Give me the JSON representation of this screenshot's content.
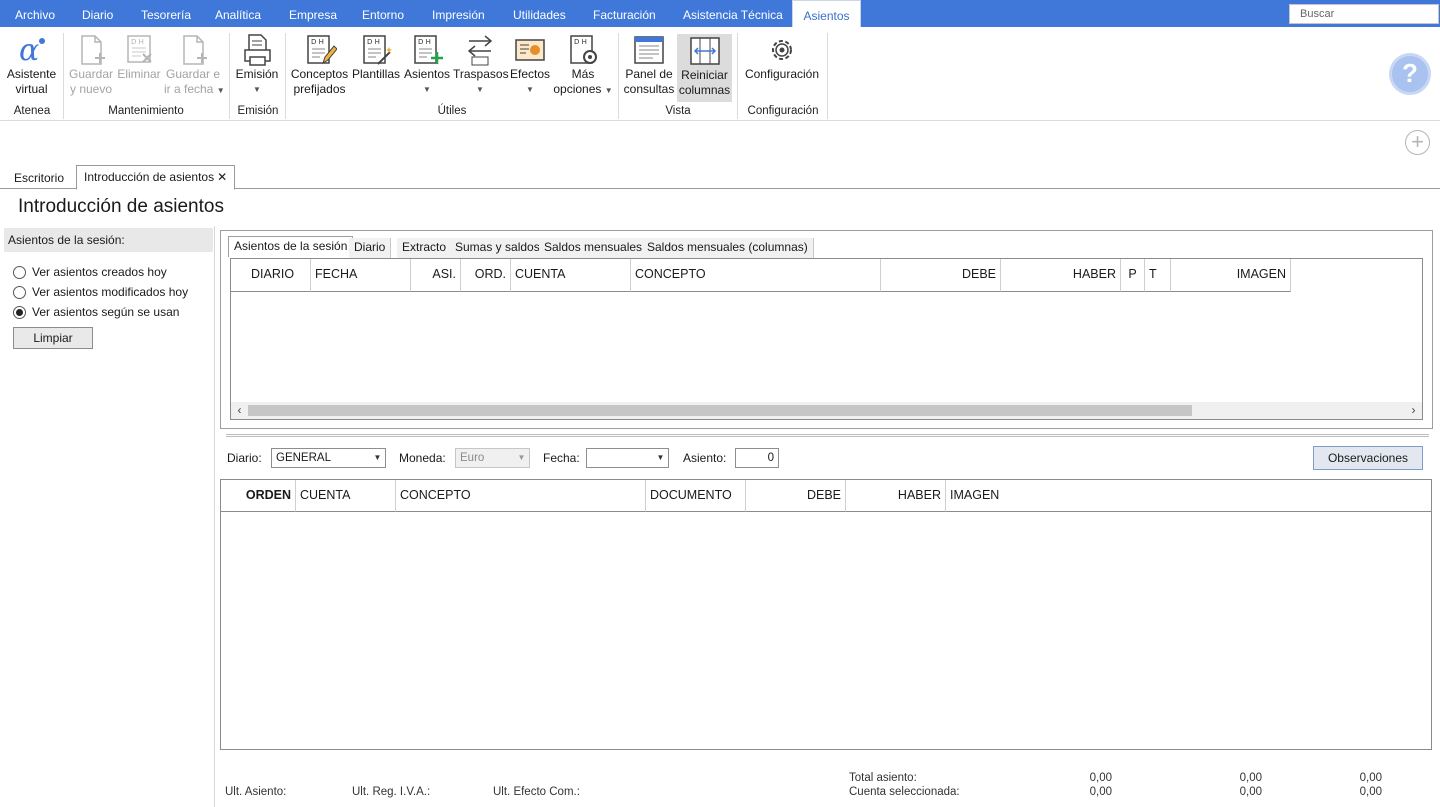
{
  "menu": {
    "items": [
      "Archivo",
      "Diario",
      "Tesorería",
      "Analítica",
      "Empresa",
      "Entorno",
      "Impresión",
      "Utilidades",
      "Facturación",
      "Asistencia Técnica",
      "Asientos"
    ],
    "search_placeholder": "Buscar"
  },
  "ribbon": {
    "asistente": [
      "Asistente",
      "virtual"
    ],
    "guardar_nuevo": [
      "Guardar",
      "y nuevo"
    ],
    "eliminar": "Eliminar",
    "guardar_fecha": [
      "Guardar e",
      "ir a fecha"
    ],
    "emision": "Emisión",
    "conceptos": [
      "Conceptos",
      "prefijados"
    ],
    "plantillas": "Plantillas",
    "asientos": "Asientos",
    "traspasos": "Traspasos",
    "efectos": "Efectos",
    "mas_opciones": [
      "Más",
      "opciones"
    ],
    "panel_consultas": [
      "Panel de",
      "consultas"
    ],
    "reiniciar_columnas": [
      "Reiniciar",
      "columnas"
    ],
    "configuracion": "Configuración",
    "groups": {
      "atenea": "Atenea",
      "mantenimiento": "Mantenimiento",
      "emision": "Emisión",
      "utiles": "Útiles",
      "vista": "Vista",
      "configuracion": "Configuración"
    }
  },
  "doc_tabs": [
    "Escritorio",
    "Introducción de asientos"
  ],
  "page_title": "Introducción de asientos",
  "left_panel": {
    "header": "Asientos de la sesión:",
    "options": [
      {
        "label": "Ver asientos creados hoy",
        "selected": false
      },
      {
        "label": "Ver asientos modificados hoy",
        "selected": false
      },
      {
        "label": "Ver asientos según se usan",
        "selected": true
      }
    ],
    "clear_button": "Limpiar"
  },
  "upper_tabs": [
    "Asientos de la sesión",
    "Diario",
    "Extracto",
    "Sumas y saldos",
    "Saldos mensuales",
    "Saldos mensuales (columnas)"
  ],
  "upper_grid": {
    "columns": [
      "DIARIO",
      "FECHA",
      "ASI.",
      "ORD.",
      "CUENTA",
      "CONCEPTO",
      "DEBE",
      "HABER",
      "P",
      "T",
      "IMAGEN"
    ]
  },
  "form": {
    "diario_label": "Diario:",
    "diario_value": "GENERAL",
    "moneda_label": "Moneda:",
    "moneda_value": "Euro",
    "fecha_label": "Fecha:",
    "fecha_value": "",
    "asiento_label": "Asiento:",
    "asiento_value": "0",
    "observaciones_button": "Observaciones"
  },
  "lower_grid": {
    "columns": [
      "ORDEN",
      "CUENTA",
      "CONCEPTO",
      "DOCUMENTO",
      "DEBE",
      "HABER",
      "IMAGEN"
    ]
  },
  "footer": {
    "ult_asiento": "Ult. Asiento:",
    "ult_reg_iva": "Ult. Reg. I.V.A.:",
    "ult_efecto": "Ult. Efecto Com.:",
    "total_asiento": "Total asiento:",
    "cuenta_seleccionada": "Cuenta seleccionada:",
    "total_values": [
      "0,00",
      "0,00",
      "0,00"
    ],
    "cuenta_values": [
      "0,00",
      "0,00",
      "0,00"
    ]
  },
  "colors": {
    "menu_bg": "#3f78d8",
    "help": "#a9c2ef",
    "selected_button": "#dcdcdc"
  }
}
